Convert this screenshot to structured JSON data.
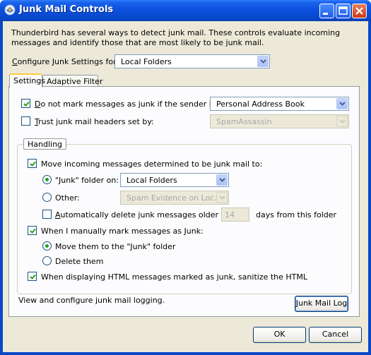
{
  "window": {
    "title": "Junk Mail Controls",
    "title_icon": "thunderbird-icon",
    "controls": [
      "minimize-icon",
      "maximize-icon",
      "close-icon"
    ]
  },
  "intro": "Thunderbird has several ways to detect junk mail. These controls evaluate incoming messages and identify those that are most likely to be junk mail.",
  "configure": {
    "label_hot": "C",
    "label_rest": "onfigure Junk Settings for:",
    "value": "Local Folders"
  },
  "tabs": [
    {
      "label": "Settings",
      "active": true
    },
    {
      "label": "Adaptive Filter",
      "active": false
    }
  ],
  "settings": {
    "whitelist": {
      "checked": true,
      "label_hot": "D",
      "label_rest": "o not mark messages as junk if the sender is in:",
      "value": "Personal Address Book"
    },
    "trust_headers": {
      "checked": false,
      "label_hot": "T",
      "label_rest": "rust junk mail headers set by:",
      "value": "SpamAssassin"
    },
    "handling": {
      "title": "Handling",
      "move_incoming": {
        "checked": true,
        "label": "Move incoming messages determined to be junk mail to:"
      },
      "junk_folder": {
        "selected": true,
        "label": "\"Junk\" folder on:",
        "value": "Local Folders"
      },
      "other": {
        "selected": false,
        "label": "Other:",
        "value": "Spam Evidence on Loc..."
      },
      "auto_delete": {
        "checked": false,
        "label_hot": "A",
        "label_rest": "utomatically delete junk messages older than",
        "days": "14",
        "suffix": "days from this folder"
      },
      "manual_mark": {
        "checked": true,
        "label": "When I manually mark messages as Junk:"
      },
      "move_to_junk": {
        "selected": true,
        "label": "Move them to the \"Junk\" folder"
      },
      "delete_them": {
        "selected": false,
        "label": "Delete them"
      },
      "sanitize": {
        "checked": true,
        "label": "When displaying HTML messages marked as junk, sanitize the HTML"
      }
    },
    "logging": {
      "label": "View and configure junk mail logging.",
      "button_hot": "J",
      "button_rest": "unk Mail Log"
    }
  },
  "buttons": {
    "ok": "OK",
    "cancel": "Cancel"
  }
}
